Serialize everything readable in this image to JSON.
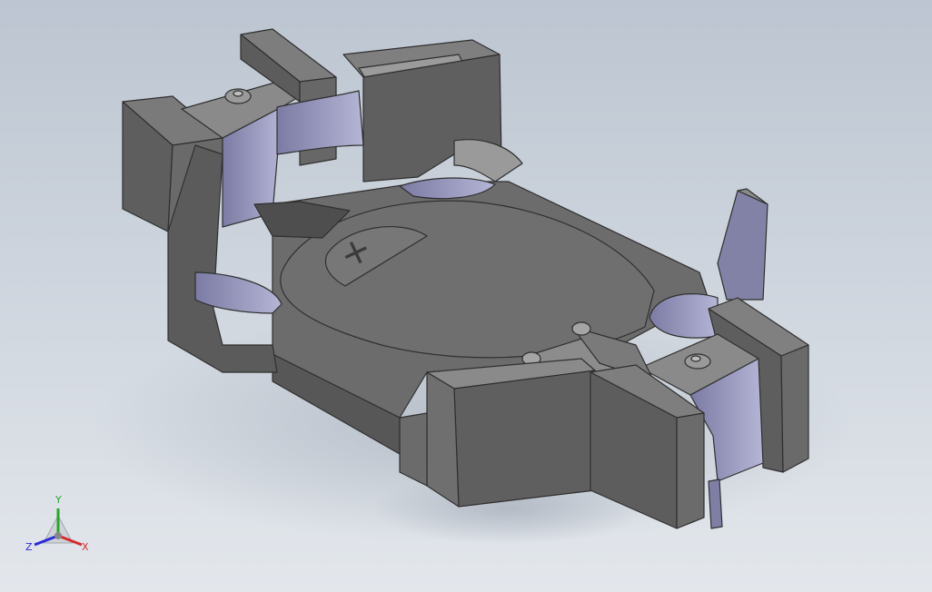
{
  "viewport": {
    "background_top": "#bcc5d1",
    "background_bottom": "#e3e7ec",
    "model_color": "#686868",
    "model_dark": "#555555",
    "model_light": "#8a8a8a",
    "model_edge": "#2f2f2f",
    "slot_tint": "#9c9cc0",
    "shadow_color": "#aab3bf"
  },
  "model": {
    "polarity_mark": "+"
  },
  "triad": {
    "x_label": "X",
    "y_label": "Y",
    "z_label": "Z",
    "x_color": "#d62b2b",
    "y_color": "#2aa52a",
    "z_color": "#2b2bd6"
  }
}
